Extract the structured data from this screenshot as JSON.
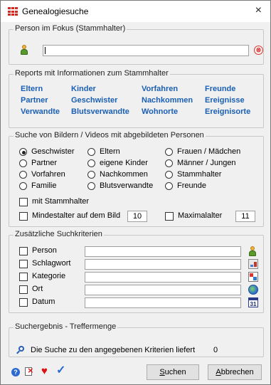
{
  "window": {
    "title": "Genealogiesuche",
    "close_glyph": "×"
  },
  "person_focus": {
    "legend": "Person im Fokus (Stammhalter)",
    "value": "",
    "icon": "person-icon",
    "clear_icon": "clear-icon",
    "clear_glyph": "⊗"
  },
  "reports": {
    "legend": "Reports mit Informationen zum Stammhalter",
    "link_color": "#1a5fb4",
    "links": [
      "Eltern",
      "Kinder",
      "Vorfahren",
      "Freunde",
      "Partner",
      "Geschwister",
      "Nachkommen",
      "Ereignisse",
      "Verwandte",
      "Blutsverwandte",
      "Wohnorte",
      "Ereignisorte"
    ]
  },
  "media_search": {
    "legend": "Suche von Bildern / Videos mit abgebildeten Personen",
    "radios": [
      {
        "label": "Geschwister",
        "selected": true
      },
      {
        "label": "Eltern",
        "selected": false
      },
      {
        "label": "Frauen / Mädchen",
        "selected": false
      },
      {
        "label": "Partner",
        "selected": false
      },
      {
        "label": "eigene Kinder",
        "selected": false
      },
      {
        "label": "Männer / Jungen",
        "selected": false
      },
      {
        "label": "Vorfahren",
        "selected": false
      },
      {
        "label": "Nachkommen",
        "selected": false
      },
      {
        "label": "Stammhalter",
        "selected": false
      },
      {
        "label": "Familie",
        "selected": false
      },
      {
        "label": "Blutsverwandte",
        "selected": false
      },
      {
        "label": "Freunde",
        "selected": false
      }
    ],
    "with_root": {
      "label": "mit Stammhalter",
      "checked": false
    },
    "min_age": {
      "label": "Mindestalter auf dem Bild",
      "checked": false,
      "value": "10"
    },
    "max_age": {
      "label": "Maximalalter",
      "checked": false,
      "value": "11"
    }
  },
  "criteria": {
    "legend": "Zusätzliche Suchkriterien",
    "rows": [
      {
        "label": "Person",
        "value": "",
        "icon": "person-icon"
      },
      {
        "label": "Schlagwort",
        "value": "",
        "icon": "tag-icon"
      },
      {
        "label": "Kategorie",
        "value": "",
        "icon": "category-icon"
      },
      {
        "label": "Ort",
        "value": "",
        "icon": "globe-icon"
      },
      {
        "label": "Datum",
        "value": "",
        "icon": "calendar-icon",
        "icon_text": "31"
      }
    ]
  },
  "result": {
    "legend": "Suchergebnis - Treffermenge",
    "text": "Die Suche zu den angegebenen Kriterien liefert",
    "count": "0"
  },
  "footer": {
    "icons": [
      "help-icon",
      "edit-icon",
      "heart-icon",
      "check-icon"
    ],
    "help_glyph": "?",
    "heart_glyph": "♥",
    "check_glyph": "✓",
    "search_button": {
      "first": "S",
      "rest": "uchen"
    },
    "cancel_button": {
      "first": "A",
      "rest": "bbrechen"
    }
  }
}
